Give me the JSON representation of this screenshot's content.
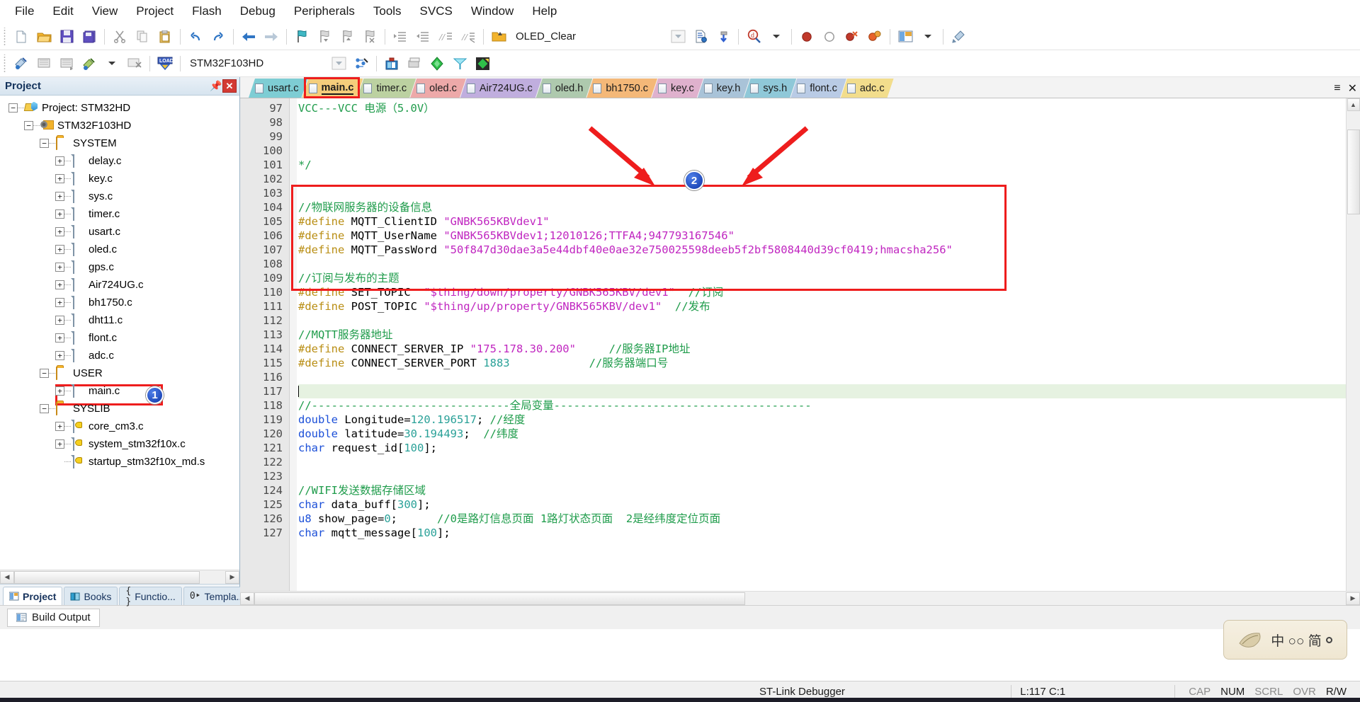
{
  "menu": {
    "items": [
      "File",
      "Edit",
      "View",
      "Project",
      "Flash",
      "Debug",
      "Peripherals",
      "Tools",
      "SVCS",
      "Window",
      "Help"
    ]
  },
  "toolbar1": {
    "icons": [
      {
        "name": "new-file-icon",
        "glyph": "⬜"
      },
      {
        "name": "open-file-icon",
        "glyph": "📂"
      },
      {
        "name": "save-icon",
        "glyph": "💾"
      },
      {
        "name": "save-all-icon",
        "glyph": "💾"
      },
      {
        "name": "cut-icon",
        "glyph": "✂"
      },
      {
        "name": "copy-icon",
        "glyph": "❐"
      },
      {
        "name": "paste-icon",
        "glyph": "📋"
      },
      {
        "name": "undo-icon",
        "glyph": "↶"
      },
      {
        "name": "redo-icon",
        "glyph": "↷"
      },
      {
        "name": "navigate-back-icon",
        "glyph": "←"
      },
      {
        "name": "navigate-forward-icon",
        "glyph": "→"
      },
      {
        "name": "bookmark-toggle-icon",
        "glyph": "⚑"
      },
      {
        "name": "bookmark-prev-icon",
        "glyph": "⚑"
      },
      {
        "name": "bookmark-next-icon",
        "glyph": "⚑"
      },
      {
        "name": "bookmark-clear-icon",
        "glyph": "⚑"
      },
      {
        "name": "indent-increase-icon",
        "glyph": "⇥"
      },
      {
        "name": "indent-decrease-icon",
        "glyph": "⇤"
      },
      {
        "name": "comment-lines-icon",
        "glyph": "//"
      },
      {
        "name": "uncomment-lines-icon",
        "glyph": "//"
      }
    ],
    "function_combo": {
      "icon": "function-browse-icon",
      "value": "OLED_Clear",
      "dropdown_icon": "chevron-down-icon"
    },
    "after_combo_icons": [
      {
        "name": "insert-file-icon"
      },
      {
        "name": "configure-icon"
      },
      {
        "name": "find-in-files-icon"
      },
      {
        "name": "find-dropdown-icon"
      },
      {
        "name": "breakpoint-insert-icon"
      },
      {
        "name": "breakpoint-disable-icon"
      },
      {
        "name": "breakpoint-kill-all-icon"
      },
      {
        "name": "breakpoint-disable-all-icon"
      },
      {
        "name": "window-layout-icon"
      },
      {
        "name": "layout-dropdown-icon"
      },
      {
        "name": "configure-target-icon"
      }
    ]
  },
  "toolbar2": {
    "left_icons": [
      {
        "name": "translate-icon"
      },
      {
        "name": "build-icon"
      },
      {
        "name": "rebuild-icon"
      },
      {
        "name": "batch-build-icon"
      },
      {
        "name": "batch-build-dropdown-icon"
      },
      {
        "name": "stop-build-icon"
      },
      {
        "name": "download-icon"
      }
    ],
    "target_combo": {
      "value": "STM32F103HD",
      "dropdown_icon": "chevron-down-icon"
    },
    "right_icons": [
      {
        "name": "target-options-icon"
      },
      {
        "name": "manage-project-items-icon"
      },
      {
        "name": "manage-run-time-env-icon"
      },
      {
        "name": "pack-installer-icon"
      },
      {
        "name": "select-software-packs-icon"
      },
      {
        "name": "manage-multi-project-icon"
      }
    ]
  },
  "project_panel": {
    "title": "Project",
    "pin_icon": "pin-icon",
    "close_icon": "close-icon",
    "tree": [
      {
        "label": "Project: STM32HD",
        "depth": 0,
        "icon": "project-icon",
        "expander": "minus"
      },
      {
        "label": "STM32F103HD",
        "depth": 1,
        "icon": "target-icon",
        "expander": "minus"
      },
      {
        "label": "SYSTEM",
        "depth": 2,
        "icon": "folder-icon",
        "expander": "minus"
      },
      {
        "label": "delay.c",
        "depth": 3,
        "icon": "file-icon",
        "expander": "plus"
      },
      {
        "label": "key.c",
        "depth": 3,
        "icon": "file-icon",
        "expander": "plus"
      },
      {
        "label": "sys.c",
        "depth": 3,
        "icon": "file-icon",
        "expander": "plus"
      },
      {
        "label": "timer.c",
        "depth": 3,
        "icon": "file-icon",
        "expander": "plus"
      },
      {
        "label": "usart.c",
        "depth": 3,
        "icon": "file-icon",
        "expander": "plus"
      },
      {
        "label": "oled.c",
        "depth": 3,
        "icon": "file-icon",
        "expander": "plus"
      },
      {
        "label": "gps.c",
        "depth": 3,
        "icon": "file-icon",
        "expander": "plus"
      },
      {
        "label": "Air724UG.c",
        "depth": 3,
        "icon": "file-icon",
        "expander": "plus"
      },
      {
        "label": "bh1750.c",
        "depth": 3,
        "icon": "file-icon",
        "expander": "plus"
      },
      {
        "label": "dht11.c",
        "depth": 3,
        "icon": "file-icon",
        "expander": "plus"
      },
      {
        "label": "flont.c",
        "depth": 3,
        "icon": "file-icon",
        "expander": "plus"
      },
      {
        "label": "adc.c",
        "depth": 3,
        "icon": "file-icon",
        "expander": "plus"
      },
      {
        "label": "USER",
        "depth": 2,
        "icon": "folder-icon",
        "expander": "minus"
      },
      {
        "label": "main.c",
        "depth": 3,
        "icon": "file-icon",
        "expander": "plus",
        "highlighted": true
      },
      {
        "label": "SYSLIB",
        "depth": 2,
        "icon": "folder-icon",
        "expander": "minus"
      },
      {
        "label": "core_cm3.c",
        "depth": 3,
        "icon": "file-key-icon",
        "expander": "plus"
      },
      {
        "label": "system_stm32f10x.c",
        "depth": 3,
        "icon": "file-key-icon",
        "expander": "plus"
      },
      {
        "label": "startup_stm32f10x_md.s",
        "depth": 3,
        "icon": "file-key-icon",
        "expander": "none"
      }
    ],
    "bottom_tabs": [
      {
        "label": "Project",
        "icon": "project-tab-icon",
        "active": true
      },
      {
        "label": "Books",
        "icon": "books-icon",
        "active": false
      },
      {
        "label": "Functio...",
        "icon": "functions-icon",
        "active": false
      },
      {
        "label": "Templa...",
        "icon": "templates-icon",
        "active": false
      }
    ]
  },
  "build_output": {
    "label": "Build Output",
    "icon": "build-output-icon"
  },
  "editor": {
    "tabs": [
      {
        "label": "usart.c",
        "color": "#7ecdd4",
        "active": false
      },
      {
        "label": "main.c",
        "color": "#f5cd7b",
        "active": true
      },
      {
        "label": "timer.c",
        "color": "#bcd1a1",
        "active": false
      },
      {
        "label": "oled.c",
        "color": "#eda9a9",
        "active": false
      },
      {
        "label": "Air724UG.c",
        "color": "#c0aede",
        "active": false
      },
      {
        "label": "oled.h",
        "color": "#aec9ae",
        "active": false
      },
      {
        "label": "bh1750.c",
        "color": "#f4b878",
        "active": false
      },
      {
        "label": "key.c",
        "color": "#dfb1cd",
        "active": false
      },
      {
        "label": "key.h",
        "color": "#a9c3d8",
        "active": false
      },
      {
        "label": "sys.h",
        "color": "#8fc8d8",
        "active": false
      },
      {
        "label": "flont.c",
        "color": "#b9cbe5",
        "active": false
      },
      {
        "label": "adc.c",
        "color": "#f2dd8c",
        "active": false
      }
    ],
    "tab_controls": [
      {
        "name": "tab-list-dropdown-icon",
        "glyph": "≡"
      },
      {
        "name": "tab-close-icon",
        "glyph": "✕"
      }
    ],
    "first_line_number": 97,
    "lines": [
      {
        "n": 97,
        "tokens": [
          {
            "t": "VCC---VCC 电源（5.0V）",
            "c": "cmt"
          }
        ]
      },
      {
        "n": 98,
        "tokens": []
      },
      {
        "n": 99,
        "tokens": []
      },
      {
        "n": 100,
        "tokens": []
      },
      {
        "n": 101,
        "tokens": [
          {
            "t": "*/",
            "c": "cmt"
          }
        ]
      },
      {
        "n": 102,
        "tokens": []
      },
      {
        "n": 103,
        "tokens": []
      },
      {
        "n": 104,
        "tokens": [
          {
            "t": "//物联网服务器的设备信息",
            "c": "cmt"
          }
        ]
      },
      {
        "n": 105,
        "tokens": [
          {
            "t": "#define",
            "c": "pre"
          },
          {
            "t": " MQTT_ClientID ",
            "c": "id"
          },
          {
            "t": "\"GNBK565KBVdev1\"",
            "c": "str"
          }
        ]
      },
      {
        "n": 106,
        "tokens": [
          {
            "t": "#define",
            "c": "pre"
          },
          {
            "t": " MQTT_UserName ",
            "c": "id"
          },
          {
            "t": "\"GNBK565KBVdev1;12010126;TTFA4;947793167546\"",
            "c": "str"
          }
        ]
      },
      {
        "n": 107,
        "tokens": [
          {
            "t": "#define",
            "c": "pre"
          },
          {
            "t": " MQTT_PassWord ",
            "c": "id"
          },
          {
            "t": "\"50f847d30dae3a5e44dbf40e0ae32e750025598deeb5f2bf5808440d39cf0419;hmacsha256\"",
            "c": "str"
          }
        ]
      },
      {
        "n": 108,
        "tokens": []
      },
      {
        "n": 109,
        "tokens": [
          {
            "t": "//订阅与发布的主题",
            "c": "cmt"
          }
        ]
      },
      {
        "n": 110,
        "tokens": [
          {
            "t": "#define",
            "c": "pre"
          },
          {
            "t": " SET_TOPIC  ",
            "c": "id"
          },
          {
            "t": "\"$thing/down/property/GNBK565KBV/dev1\"",
            "c": "str"
          },
          {
            "t": "  //订阅",
            "c": "cmt"
          }
        ]
      },
      {
        "n": 111,
        "tokens": [
          {
            "t": "#define",
            "c": "pre"
          },
          {
            "t": " POST_TOPIC ",
            "c": "id"
          },
          {
            "t": "\"$thing/up/property/GNBK565KBV/dev1\"",
            "c": "str"
          },
          {
            "t": "  //发布",
            "c": "cmt"
          }
        ]
      },
      {
        "n": 112,
        "tokens": []
      },
      {
        "n": 113,
        "tokens": [
          {
            "t": "//MQTT服务器地址",
            "c": "cmt"
          }
        ]
      },
      {
        "n": 114,
        "tokens": [
          {
            "t": "#define",
            "c": "pre"
          },
          {
            "t": " CONNECT_SERVER_IP ",
            "c": "id"
          },
          {
            "t": "\"175.178.30.200\"",
            "c": "str"
          },
          {
            "t": "     //服务器IP地址",
            "c": "cmt"
          }
        ]
      },
      {
        "n": 115,
        "tokens": [
          {
            "t": "#define",
            "c": "pre"
          },
          {
            "t": " CONNECT_SERVER_PORT ",
            "c": "id"
          },
          {
            "t": "1883",
            "c": "num"
          },
          {
            "t": "            //服务器端口号",
            "c": "cmt"
          }
        ]
      },
      {
        "n": 116,
        "tokens": []
      },
      {
        "n": 117,
        "tokens": [],
        "highlight": true,
        "caret": true
      },
      {
        "n": 118,
        "tokens": [
          {
            "t": "//------------------------------全局变量---------------------------------------",
            "c": "cmt"
          }
        ]
      },
      {
        "n": 119,
        "tokens": [
          {
            "t": "double",
            "c": "kw"
          },
          {
            "t": " Longitude=",
            "c": "id"
          },
          {
            "t": "120.196517",
            "c": "num"
          },
          {
            "t": "; ",
            "c": "id"
          },
          {
            "t": "//经度",
            "c": "cmt"
          }
        ]
      },
      {
        "n": 120,
        "tokens": [
          {
            "t": "double",
            "c": "kw"
          },
          {
            "t": " latitude=",
            "c": "id"
          },
          {
            "t": "30.194493",
            "c": "num"
          },
          {
            "t": ";  ",
            "c": "id"
          },
          {
            "t": "//纬度",
            "c": "cmt"
          }
        ]
      },
      {
        "n": 121,
        "tokens": [
          {
            "t": "char",
            "c": "kw"
          },
          {
            "t": " request_id[",
            "c": "id"
          },
          {
            "t": "100",
            "c": "num"
          },
          {
            "t": "];",
            "c": "id"
          }
        ]
      },
      {
        "n": 122,
        "tokens": []
      },
      {
        "n": 123,
        "tokens": []
      },
      {
        "n": 124,
        "tokens": [
          {
            "t": "//WIFI发送数据存储区域",
            "c": "cmt"
          }
        ]
      },
      {
        "n": 125,
        "tokens": [
          {
            "t": "char",
            "c": "kw"
          },
          {
            "t": " data_buff[",
            "c": "id"
          },
          {
            "t": "300",
            "c": "num"
          },
          {
            "t": "];",
            "c": "id"
          }
        ]
      },
      {
        "n": 126,
        "tokens": [
          {
            "t": "u8",
            "c": "kw"
          },
          {
            "t": " show_page=",
            "c": "id"
          },
          {
            "t": "0",
            "c": "num"
          },
          {
            "t": ";      ",
            "c": "id"
          },
          {
            "t": "//0是路灯信息页面 1路灯状态页面  2是经纬度定位页面",
            "c": "cmt"
          }
        ]
      },
      {
        "n": 127,
        "tokens": [
          {
            "t": "char",
            "c": "kw"
          },
          {
            "t": " mqtt_message[",
            "c": "id"
          },
          {
            "t": "100",
            "c": "num"
          },
          {
            "t": "];",
            "c": "id"
          }
        ]
      }
    ]
  },
  "annotations": [
    {
      "id": "1",
      "label": "1",
      "target": "main.c tree item"
    },
    {
      "id": "2",
      "label": "2",
      "target": "MQTT defines block"
    }
  ],
  "watermark": {
    "text": "中 ○○ 简"
  },
  "statusbar": {
    "debugger": "ST-Link Debugger",
    "position": "L:117 C:1",
    "flags": [
      {
        "label": "CAP",
        "on": false
      },
      {
        "label": "NUM",
        "on": true
      },
      {
        "label": "SCRL",
        "on": false
      },
      {
        "label": "OVR",
        "on": false
      },
      {
        "label": "R/W",
        "on": true
      }
    ]
  }
}
